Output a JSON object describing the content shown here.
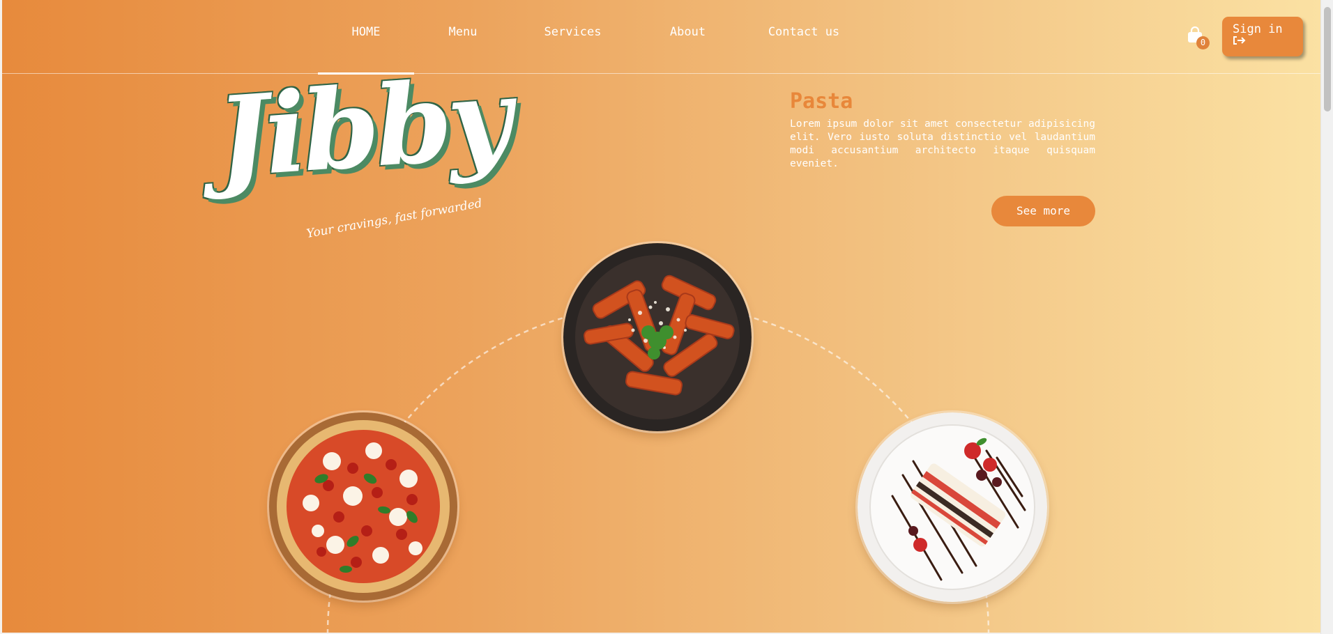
{
  "nav": {
    "items": [
      {
        "label": "HOME",
        "active": true
      },
      {
        "label": "Menu",
        "active": false
      },
      {
        "label": "Services",
        "active": false
      },
      {
        "label": "About",
        "active": false
      },
      {
        "label": "Contact us",
        "active": false
      }
    ]
  },
  "cart": {
    "count": "0",
    "icon": "shopping-bag-icon"
  },
  "signin": {
    "label": "Sign in",
    "icon": "sign-in-arrow-icon"
  },
  "logo": {
    "word": "Jibby",
    "tagline": "Your cravings, fast forwarded"
  },
  "feature": {
    "title": "Pasta",
    "description": "Lorem ipsum dolor sit amet consectetur adipisicing elit. Vero iusto soluta distinctio vel laudantium modi accusantium architecto itaque quisquam eveniet.",
    "button_label": "See more"
  },
  "dishes": [
    {
      "name": "pasta",
      "selected": true
    },
    {
      "name": "pizza",
      "selected": false
    },
    {
      "name": "cake",
      "selected": false
    }
  ],
  "colors": {
    "accent": "#e8883b",
    "logo_shadow": "#4c8a63",
    "gradient_start": "#e78a3c",
    "gradient_end": "#fbe2a4"
  }
}
